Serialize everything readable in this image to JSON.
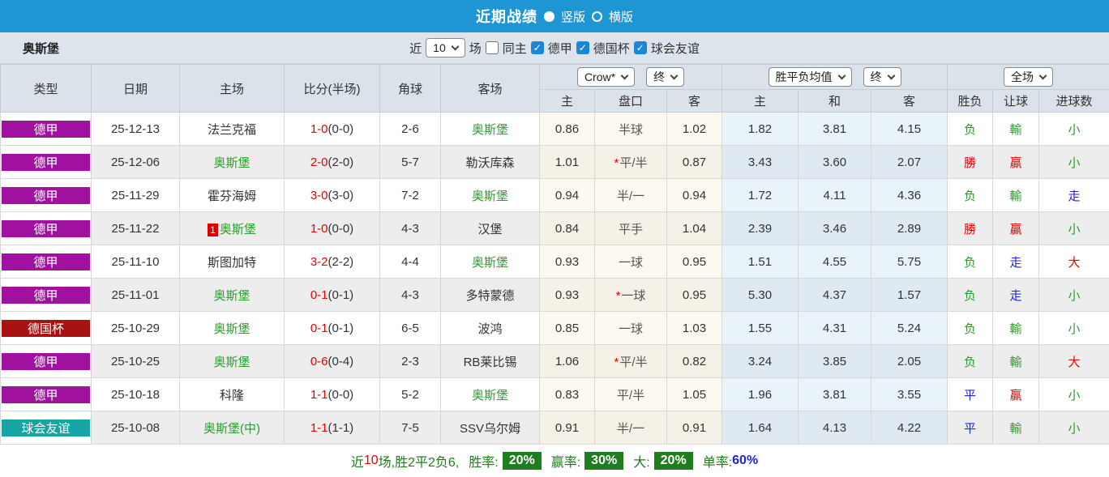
{
  "topbar": {
    "title": "近期战绩",
    "vertical_label": "竖版",
    "horizontal_label": "横版"
  },
  "filterbar": {
    "team": "奥斯堡",
    "near_label": "近",
    "games_value": "10",
    "games_label": "场",
    "same_home_label": "同主",
    "leagues": [
      "德甲",
      "德国杯",
      "球会友谊"
    ]
  },
  "header": {
    "cols": [
      "类型",
      "日期",
      "主场",
      "比分(半场)",
      "角球",
      "客场"
    ],
    "bookmaker_select": "Crow*",
    "odds_final_select": "终",
    "avg_select": "胜平负均值",
    "avg_final_select": "终",
    "scope_select": "全场",
    "sub": [
      "主",
      "盘口",
      "客",
      "主",
      "和",
      "客",
      "胜负",
      "让球",
      "进球数"
    ]
  },
  "table": {
    "type_colors": {
      "德甲": "#a011a0",
      "德国杯": "#a81212",
      "球会友谊": "#18a4a4"
    },
    "text_colors": {
      "green": "#2e9b2e",
      "red": "#e60000",
      "blue": "#2323dd"
    },
    "rows": [
      {
        "type": "德甲",
        "date": "25-12-13",
        "home": "法兰克福",
        "home_self": false,
        "home_prefix": "",
        "score_ft": "1-0",
        "score_ht": "(0-0)",
        "corner": "2-6",
        "away": "奥斯堡",
        "away_self": true,
        "odds_home": "0.86",
        "handicap": "半球",
        "handicap_star": false,
        "odds_away": "1.02",
        "avg_home": "1.82",
        "avg_draw": "3.81",
        "avg_away": "4.15",
        "wdl": "负",
        "wdl_c": "green",
        "let": "輸",
        "let_c": "green",
        "goal": "小",
        "goal_c": "green"
      },
      {
        "type": "德甲",
        "date": "25-12-06",
        "home": "奥斯堡",
        "home_self": true,
        "home_prefix": "",
        "score_ft": "2-0",
        "score_ht": "(2-0)",
        "corner": "5-7",
        "away": "勒沃库森",
        "away_self": false,
        "odds_home": "1.01",
        "handicap": "平/半",
        "handicap_star": true,
        "odds_away": "0.87",
        "avg_home": "3.43",
        "avg_draw": "3.60",
        "avg_away": "2.07",
        "wdl": "勝",
        "wdl_c": "red",
        "let": "贏",
        "let_c": "red",
        "goal": "小",
        "goal_c": "green"
      },
      {
        "type": "德甲",
        "date": "25-11-29",
        "home": "霍芬海姆",
        "home_self": false,
        "home_prefix": "",
        "score_ft": "3-0",
        "score_ht": "(3-0)",
        "corner": "7-2",
        "away": "奥斯堡",
        "away_self": true,
        "odds_home": "0.94",
        "handicap": "半/一",
        "handicap_star": false,
        "odds_away": "0.94",
        "avg_home": "1.72",
        "avg_draw": "4.11",
        "avg_away": "4.36",
        "wdl": "负",
        "wdl_c": "green",
        "let": "輸",
        "let_c": "green",
        "goal": "走",
        "goal_c": "blue"
      },
      {
        "type": "德甲",
        "date": "25-11-22",
        "home": "奥斯堡",
        "home_self": true,
        "home_prefix": "1",
        "score_ft": "1-0",
        "score_ht": "(0-0)",
        "corner": "4-3",
        "away": "汉堡",
        "away_self": false,
        "odds_home": "0.84",
        "handicap": "平手",
        "handicap_star": false,
        "odds_away": "1.04",
        "avg_home": "2.39",
        "avg_draw": "3.46",
        "avg_away": "2.89",
        "wdl": "勝",
        "wdl_c": "red",
        "let": "贏",
        "let_c": "red",
        "goal": "小",
        "goal_c": "green"
      },
      {
        "type": "德甲",
        "date": "25-11-10",
        "home": "斯图加特",
        "home_self": false,
        "home_prefix": "",
        "score_ft": "3-2",
        "score_ht": "(2-2)",
        "corner": "4-4",
        "away": "奥斯堡",
        "away_self": true,
        "odds_home": "0.93",
        "handicap": "一球",
        "handicap_star": false,
        "odds_away": "0.95",
        "avg_home": "1.51",
        "avg_draw": "4.55",
        "avg_away": "5.75",
        "wdl": "负",
        "wdl_c": "green",
        "let": "走",
        "let_c": "blue",
        "goal": "大",
        "goal_c": "red"
      },
      {
        "type": "德甲",
        "date": "25-11-01",
        "home": "奥斯堡",
        "home_self": true,
        "home_prefix": "",
        "score_ft": "0-1",
        "score_ht": "(0-1)",
        "corner": "4-3",
        "away": "多特蒙德",
        "away_self": false,
        "odds_home": "0.93",
        "handicap": "一球",
        "handicap_star": true,
        "odds_away": "0.95",
        "avg_home": "5.30",
        "avg_draw": "4.37",
        "avg_away": "1.57",
        "wdl": "负",
        "wdl_c": "green",
        "let": "走",
        "let_c": "blue",
        "goal": "小",
        "goal_c": "green"
      },
      {
        "type": "德国杯",
        "date": "25-10-29",
        "home": "奥斯堡",
        "home_self": true,
        "home_prefix": "",
        "score_ft": "0-1",
        "score_ht": "(0-1)",
        "corner": "6-5",
        "away": "波鸿",
        "away_self": false,
        "odds_home": "0.85",
        "handicap": "一球",
        "handicap_star": false,
        "odds_away": "1.03",
        "avg_home": "1.55",
        "avg_draw": "4.31",
        "avg_away": "5.24",
        "wdl": "负",
        "wdl_c": "green",
        "let": "輸",
        "let_c": "green",
        "goal": "小",
        "goal_c": "green"
      },
      {
        "type": "德甲",
        "date": "25-10-25",
        "home": "奥斯堡",
        "home_self": true,
        "home_prefix": "",
        "score_ft": "0-6",
        "score_ht": "(0-4)",
        "corner": "2-3",
        "away": "RB莱比锡",
        "away_self": false,
        "odds_home": "1.06",
        "handicap": "平/半",
        "handicap_star": true,
        "odds_away": "0.82",
        "avg_home": "3.24",
        "avg_draw": "3.85",
        "avg_away": "2.05",
        "wdl": "负",
        "wdl_c": "green",
        "let": "輸",
        "let_c": "green",
        "goal": "大",
        "goal_c": "red"
      },
      {
        "type": "德甲",
        "date": "25-10-18",
        "home": "科隆",
        "home_self": false,
        "home_prefix": "",
        "score_ft": "1-1",
        "score_ht": "(0-0)",
        "corner": "5-2",
        "away": "奥斯堡",
        "away_self": true,
        "odds_home": "0.83",
        "handicap": "平/半",
        "handicap_star": false,
        "odds_away": "1.05",
        "avg_home": "1.96",
        "avg_draw": "3.81",
        "avg_away": "3.55",
        "wdl": "平",
        "wdl_c": "blue",
        "let": "贏",
        "let_c": "red",
        "goal": "小",
        "goal_c": "green"
      },
      {
        "type": "球会友谊",
        "date": "25-10-08",
        "home": "奥斯堡(中)",
        "home_self": true,
        "home_prefix": "",
        "score_ft": "1-1",
        "score_ht": "(1-1)",
        "corner": "7-5",
        "away": "SSV乌尔姆",
        "away_self": false,
        "odds_home": "0.91",
        "handicap": "半/一",
        "handicap_star": false,
        "odds_away": "0.91",
        "avg_home": "1.64",
        "avg_draw": "4.13",
        "avg_away": "4.22",
        "wdl": "平",
        "wdl_c": "blue",
        "let": "輸",
        "let_c": "green",
        "goal": "小",
        "goal_c": "green"
      }
    ]
  },
  "summary": {
    "near": "近",
    "games": "10",
    "record": "场,胜2平2负6,",
    "rate_label": "胜率:",
    "rate": "20%",
    "win_label": "赢率:",
    "win": "30%",
    "big_label": "大:",
    "big": "20%",
    "single_label": "单率:",
    "single": "60%"
  }
}
